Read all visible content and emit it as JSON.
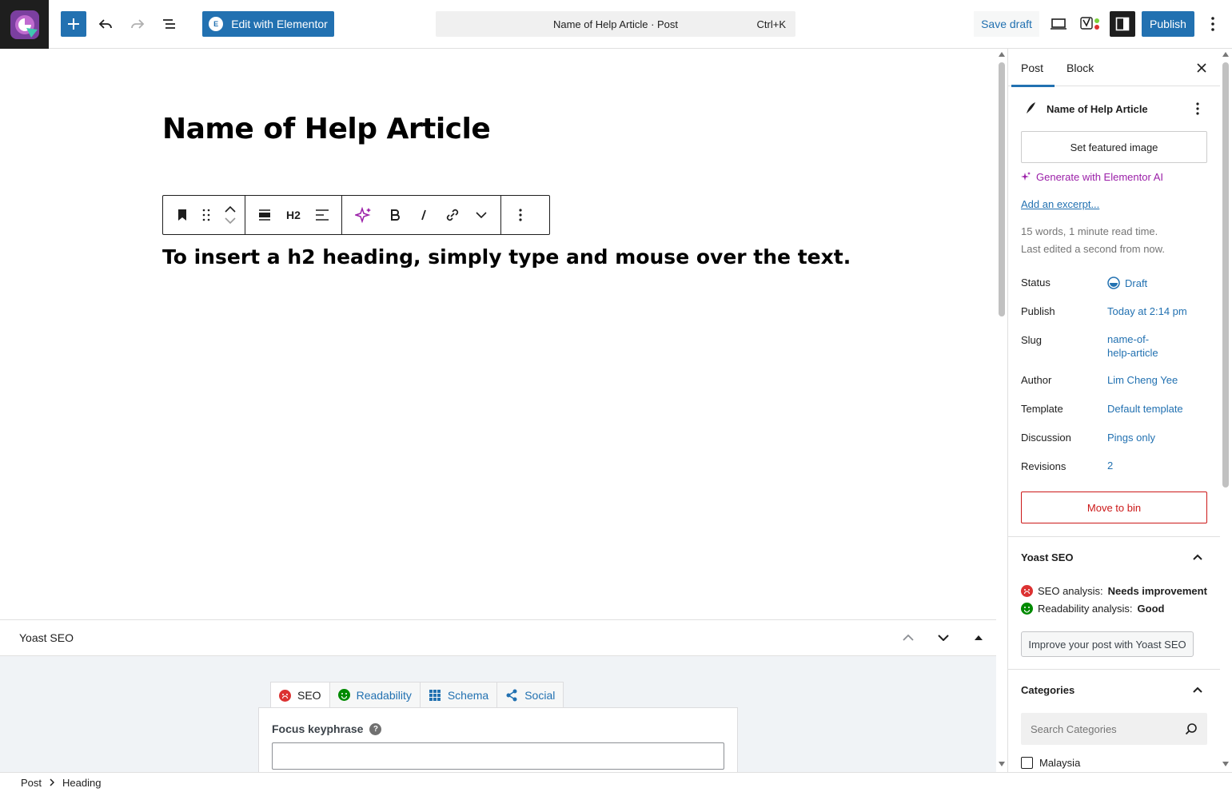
{
  "topbar": {
    "elementor_label": "Edit with Elementor",
    "command_title": "Name of Help Article · Post",
    "command_shortcut": "Ctrl+K",
    "save_draft": "Save draft",
    "publish": "Publish"
  },
  "editor": {
    "post_title": "Name of Help Article",
    "heading_level": "H2",
    "heading_text": "To insert a h2 heading, simply type and mouse over the text."
  },
  "yoast_metabox": {
    "title": "Yoast SEO",
    "tabs": [
      "SEO",
      "Readability",
      "Schema",
      "Social"
    ],
    "focus_keyphrase_label": "Focus keyphrase",
    "focus_keyphrase_value": ""
  },
  "breadcrumb": {
    "items": [
      "Post",
      "Heading"
    ]
  },
  "sidebar": {
    "tabs": [
      "Post",
      "Block"
    ],
    "post_name": "Name of Help Article",
    "featured_image": "Set featured image",
    "generate_ai": "Generate with Elementor AI",
    "add_excerpt": "Add an excerpt...",
    "word_count": "15 words, 1 minute read time.",
    "last_edited": "Last edited a second from now.",
    "rows": [
      {
        "label": "Status",
        "value": "Draft"
      },
      {
        "label": "Publish",
        "value": "Today at 2:14 pm"
      },
      {
        "label": "Slug",
        "value": "name-of-help-article",
        "value_line1": "name-of-",
        "value_line2": "help-article"
      },
      {
        "label": "Author",
        "value": "Lim Cheng Yee"
      },
      {
        "label": "Template",
        "value": "Default template"
      },
      {
        "label": "Discussion",
        "value": "Pings only"
      },
      {
        "label": "Revisions",
        "value": "2"
      }
    ],
    "move_to_bin": "Move to bin",
    "yoast": {
      "title": "Yoast SEO",
      "seo_label": "SEO analysis:",
      "seo_value": "Needs improvement",
      "readability_label": "Readability analysis:",
      "readability_value": "Good",
      "improve_button": "Improve your post with Yoast SEO"
    },
    "categories": {
      "title": "Categories",
      "search_placeholder": "Search Categories",
      "items": [
        "Malaysia"
      ]
    }
  },
  "colors": {
    "accent": "#2271b1",
    "danger": "#cc1818",
    "ai_purple": "#9b1fa8",
    "seo_bad": "#dc3232",
    "seo_good": "#008a00"
  }
}
